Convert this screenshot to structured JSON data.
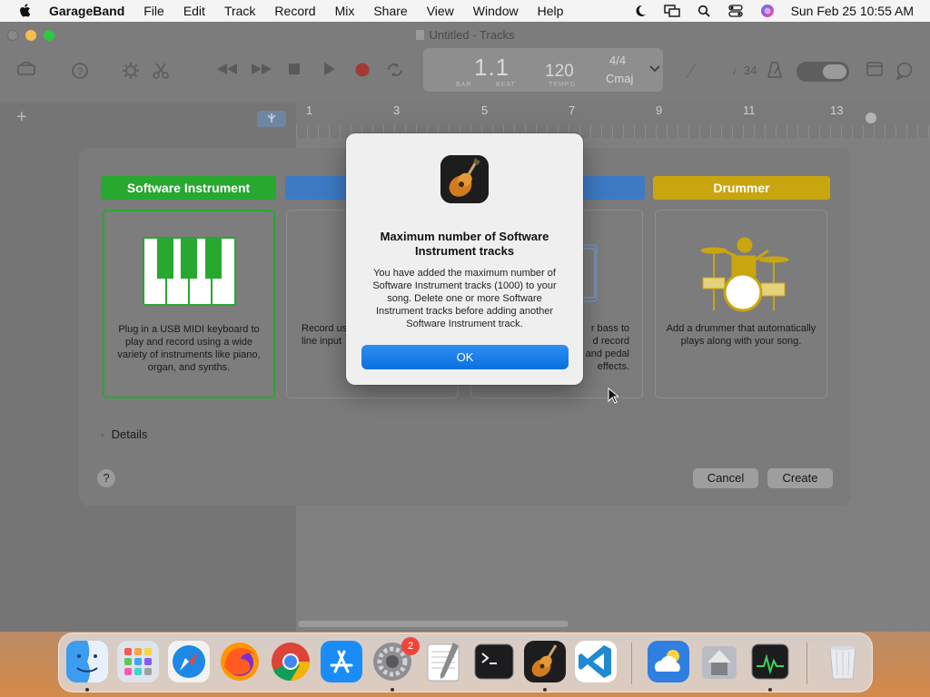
{
  "menubar": {
    "app_name": "GarageBand",
    "items": [
      "File",
      "Edit",
      "Track",
      "Record",
      "Mix",
      "Share",
      "View",
      "Window",
      "Help"
    ],
    "clock": "Sun Feb 25  10:55 AM",
    "status_icons": [
      "moon-icon",
      "screen-mirroring-icon",
      "spotlight-search-icon",
      "control-center-icon",
      "siri-icon"
    ]
  },
  "window": {
    "title": "Untitled - Tracks"
  },
  "lcd": {
    "position": "1.1",
    "bar_label": "BAR",
    "beat_label": "BEAT",
    "tempo": "120",
    "tempo_label": "TEMPO",
    "time_signature": "4/4",
    "key": "Cmaj"
  },
  "toolbar": {
    "count_in": "♩34"
  },
  "ruler": {
    "numbers": [
      "1",
      "3",
      "5",
      "7",
      "9",
      "11",
      "13"
    ]
  },
  "sheet": {
    "categories": [
      {
        "label": "Software Instrument",
        "color": "#27a82f"
      },
      {
        "label": "",
        "color": "#3d7ac4"
      },
      {
        "label": "",
        "color": "#3d7ac4"
      },
      {
        "label": "Drummer",
        "color": "#c9a50f"
      }
    ],
    "cards": [
      {
        "desc": "Plug in a USB MIDI keyboard to play and record using a wide variety of instruments like piano, organ, and synths."
      },
      {
        "desc": "Record us\nline input"
      },
      {
        "desc": "r bass to\nd record\n and pedal\neffects."
      },
      {
        "desc": "Add a drummer that automatically plays along with your song."
      }
    ],
    "details_label": "Details",
    "help_label": "?",
    "cancel_label": "Cancel",
    "create_label": "Create"
  },
  "alert": {
    "title": "Maximum number of Software Instrument tracks",
    "message": "You have added the maximum number of Software Instrument tracks (1000) to your song. Delete one or more Software Instrument tracks before adding another Software Instrument track.",
    "ok_label": "OK"
  },
  "dock": {
    "apps": [
      "Finder",
      "Launchpad",
      "Safari",
      "Firefox",
      "Google Chrome",
      "App Store",
      "System Settings",
      "TextEdit",
      "Terminal",
      "GarageBand",
      "Visual Studio Code",
      "Weather",
      "Migration Assistant",
      "Activity Monitor",
      "Trash"
    ],
    "settings_badge": "2"
  }
}
